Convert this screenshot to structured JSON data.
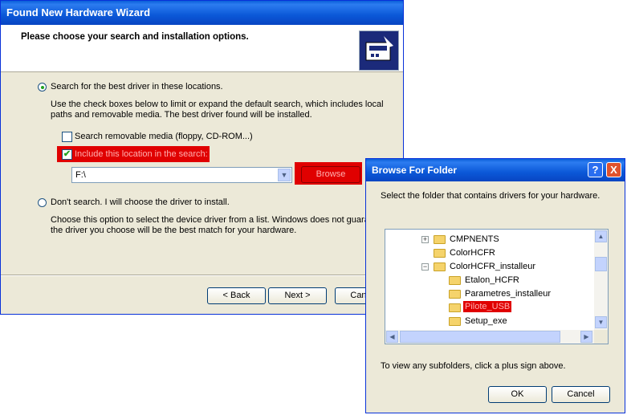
{
  "wizard": {
    "title": "Found New Hardware Wizard",
    "heading": "Please choose your search and installation options.",
    "icon": "hardware-install-icon",
    "option_search": {
      "label": "Search for the best driver in these locations.",
      "selected": true,
      "description_line1": "Use the check boxes below to limit or expand the default search, which includes local",
      "description_line2": "paths and removable media. The best driver found will be installed.",
      "check_removable_label": "Search removable media (floppy, CD-ROM...)",
      "check_removable_checked": false,
      "check_location_label": "Include this location in the search:",
      "check_location_checked": true,
      "location_value": "F:\\",
      "browse_label": "Browse"
    },
    "option_dont_search": {
      "label": "Don't search. I will choose the driver to install.",
      "selected": false,
      "description_line1": "Choose this option to select the device driver from a list.  Windows does not guarant",
      "description_line2": "the driver you choose will be the best match for your hardware."
    },
    "buttons": {
      "back": "< Back",
      "next": "Next >",
      "cancel": "Cancel"
    },
    "highlight_color": "#e00000"
  },
  "browse_dialog": {
    "title": "Browse For Folder",
    "help_label": "?",
    "close_label": "X",
    "instruction": "Select the folder that contains drivers for your hardware.",
    "tree": [
      {
        "label": "CMPNENTS",
        "expander": "+"
      },
      {
        "label": "ColorHCFR",
        "expander": ""
      },
      {
        "label": "ColorHCFR_installeur",
        "expander": "−"
      },
      {
        "label": "Etalon_HCFR",
        "expander": ""
      },
      {
        "label": "Parametres_installeur",
        "expander": ""
      },
      {
        "label": "Pilote_USB",
        "expander": "",
        "selected": true
      },
      {
        "label": "Setup_exe",
        "expander": ""
      }
    ],
    "hint": "To view any subfolders, click a plus sign above.",
    "ok_label": "OK",
    "cancel_label": "Cancel"
  }
}
